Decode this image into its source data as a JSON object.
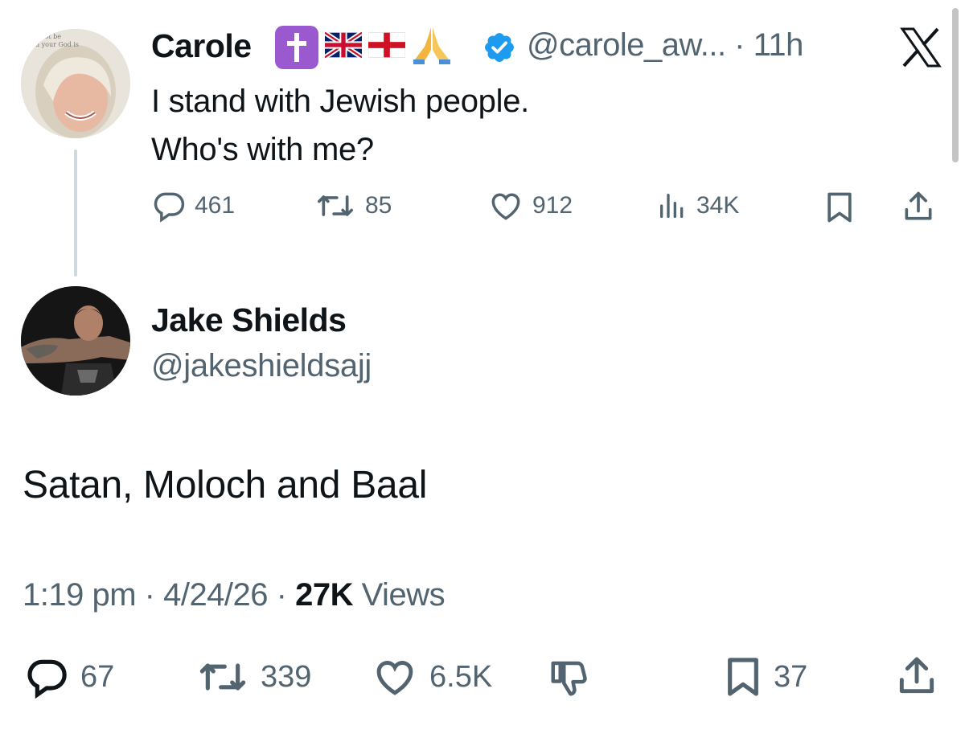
{
  "parent_tweet": {
    "author_name": "Carole",
    "emojis": [
      "✝️",
      "🇬🇧",
      "🏴",
      "🙏"
    ],
    "handle_time": "@carole_aw... · 11h",
    "text_line1": "I stand with Jewish people.",
    "text_line2": "Who's with me?",
    "replies": "461",
    "reposts": "85",
    "likes": "912",
    "views": "34K"
  },
  "main_tweet": {
    "author_name": "Jake Shields",
    "handle": "@jakeshieldsajj",
    "text": "Satan, Moloch and Baal",
    "timestamp": "1:19 pm · 4/24/26 · ",
    "views_count": "27K",
    "views_label": " Views",
    "replies": "67",
    "reposts": "339",
    "likes": "6.5K",
    "bookmarks": "37"
  },
  "icons": {
    "reply": "reply-icon",
    "repost": "repost-icon",
    "like": "like-icon",
    "views": "views-icon",
    "bookmark": "bookmark-icon",
    "share": "share-icon",
    "dislike": "dislike-icon",
    "verified": "verified-badge-icon",
    "close": "x-logo-icon"
  },
  "colors": {
    "text": "#0f1419",
    "muted": "#536471",
    "verified": "#1d9bf0"
  }
}
